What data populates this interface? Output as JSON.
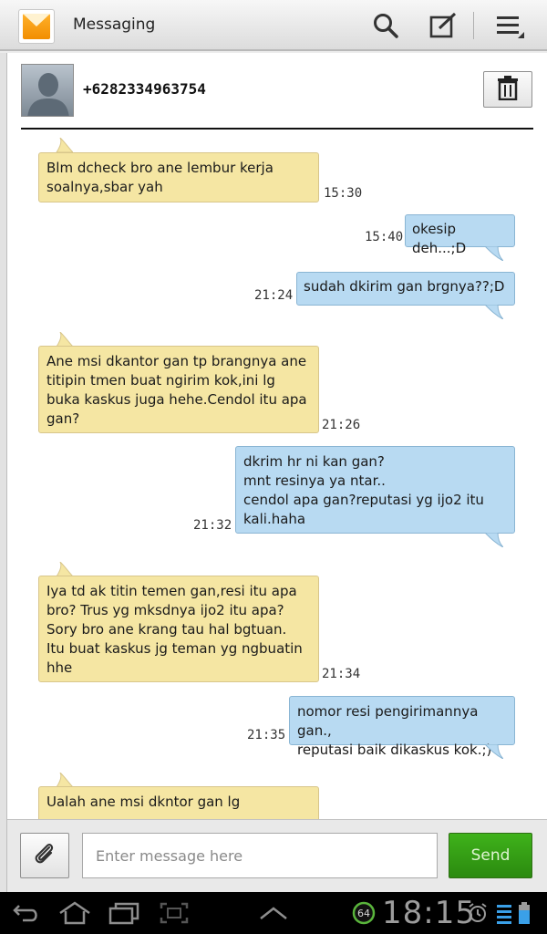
{
  "app": {
    "title": "Messaging"
  },
  "actionbar": {
    "icons": [
      "search-icon",
      "compose-icon",
      "overflow-menu-icon"
    ]
  },
  "contact": {
    "number": "+6282334963754"
  },
  "messages": [
    {
      "direction": "in",
      "text": "Blm dcheck bro ane lembur kerja\nsoalnya,sbar yah",
      "time": "15:30"
    },
    {
      "direction": "out",
      "text": "okesip deh...;D",
      "time": "15:40"
    },
    {
      "direction": "out",
      "text": "sudah dkirim gan brgnya??;D",
      "time": "21:24"
    },
    {
      "direction": "in",
      "text": "Ane msi dkantor gan tp brangnya ane\ntitipin tmen buat ngirim kok,ini lg\nbuka kaskus juga hehe.Cendol itu apa\ngan?",
      "time": "21:26"
    },
    {
      "direction": "out",
      "text": "dkrim hr ni kan gan?\nmnt resinya ya ntar..\ncendol apa gan?reputasi yg ijo2 itu\nkali.haha",
      "time": "21:32"
    },
    {
      "direction": "in",
      "text": "Iya td ak titin temen gan,resi itu apa\nbro? Trus yg mksdnya ijo2 itu apa?\nSory bro ane krang tau hal bgtuan.\nItu buat kaskus jg teman yg ngbuatin\nhhe",
      "time": "21:34"
    },
    {
      "direction": "out",
      "text": "nomor resi pengirimannya gan.,\nreputasi baik dikaskus kok.;)",
      "time": "21:35"
    },
    {
      "direction": "in",
      "text": "Ualah ane msi dkntor gan lg",
      "time": ""
    }
  ],
  "composer": {
    "placeholder": "Enter message here",
    "send_label": "Send"
  },
  "statusbar": {
    "clock": "18:15",
    "badge": "64"
  },
  "colors": {
    "incoming": "#f5e6a3",
    "outgoing": "#b8daf2",
    "send": "#2b8a0f"
  }
}
